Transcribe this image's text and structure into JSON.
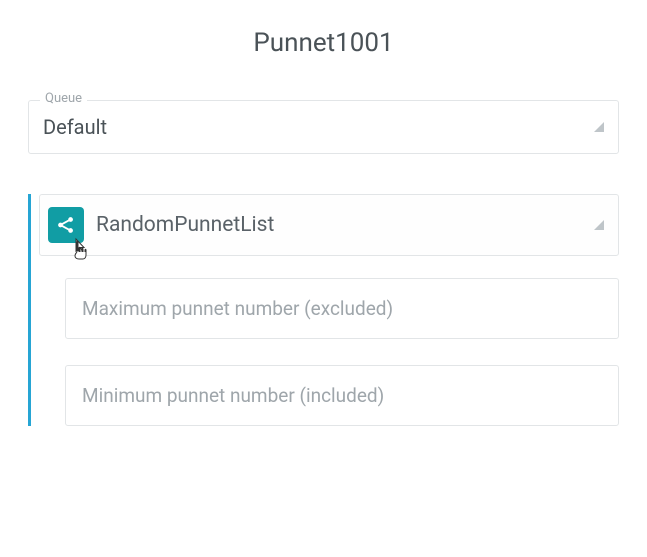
{
  "title": "Punnet1001",
  "queue": {
    "label": "Queue",
    "value": "Default"
  },
  "component": {
    "name": "RandomPunnetList",
    "icon": "share-icon",
    "fields": {
      "max_placeholder": "Maximum punnet number (excluded)",
      "min_placeholder": "Minimum punnet number (included)"
    }
  }
}
